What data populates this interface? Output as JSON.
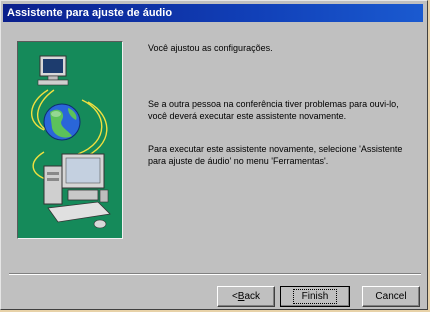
{
  "window": {
    "title": "Assistente para ajuste de áudio"
  },
  "content": {
    "heading": "Você ajustou as configurações.",
    "paragraph1": "Se a outra pessoa na conferência tiver problemas para ouvi-lo, você deverá executar este assistente novamente.",
    "paragraph2": "Para executar este assistente novamente, selecione 'Assistente para ajuste de áudio' no menu 'Ferramentas'."
  },
  "buttons": {
    "back_prefix": "< ",
    "back_key": "B",
    "back_rest": "ack",
    "finish": "Finish",
    "cancel": "Cancel"
  },
  "colors": {
    "titlebar": "#0a1f8c",
    "art_panel": "#158a5a",
    "dialog": "#c0c0c0"
  },
  "icons": [
    "monitor-icon",
    "globe-icon",
    "computer-icon"
  ]
}
